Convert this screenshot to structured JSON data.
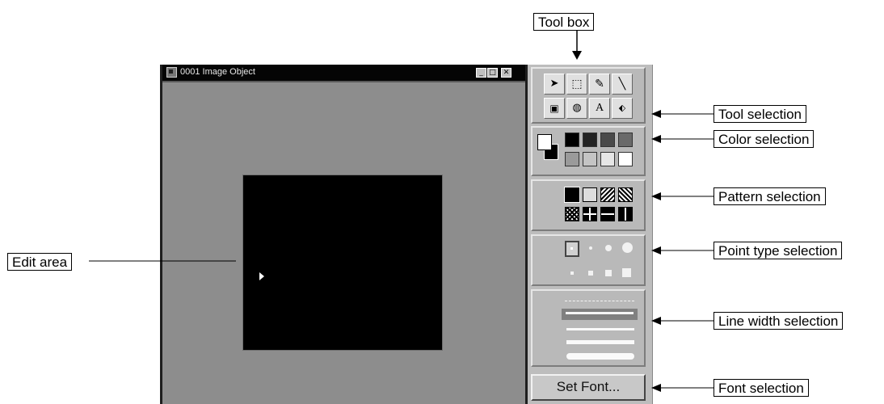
{
  "window": {
    "title": "0001 Image Object",
    "minimize_glyph": "_",
    "maximize_glyph": "□",
    "close_glyph": "✕"
  },
  "toolbox": {
    "tools": [
      {
        "name": "select-arrow-icon",
        "glyph": "➤"
      },
      {
        "name": "marquee-icon",
        "glyph": "⬚"
      },
      {
        "name": "pencil-icon",
        "glyph": "✎"
      },
      {
        "name": "line-icon",
        "glyph": "╲"
      },
      {
        "name": "rectangle-icon",
        "glyph": "▣"
      },
      {
        "name": "ellipse-icon",
        "glyph": "◍"
      },
      {
        "name": "text-icon",
        "glyph": "A"
      },
      {
        "name": "fill-icon",
        "glyph": "⬖"
      }
    ],
    "colors_row1": [
      "#000000",
      "#222222",
      "#4a4a4a",
      "#6a6a6a"
    ],
    "colors_row2": [
      "#9a9a9a",
      "#c4c4c4",
      "#e6e6e6",
      "#ffffff"
    ],
    "set_font_label": "Set Font..."
  },
  "labels": {
    "toolbox": "Tool box",
    "tool_selection": "Tool selection",
    "color_selection": "Color selection",
    "pattern_selection": "Pattern selection",
    "point_type_selection": "Point type selection",
    "line_width_selection": "Line width selection",
    "font_selection": "Font selection",
    "edit_area": "Edit area"
  }
}
